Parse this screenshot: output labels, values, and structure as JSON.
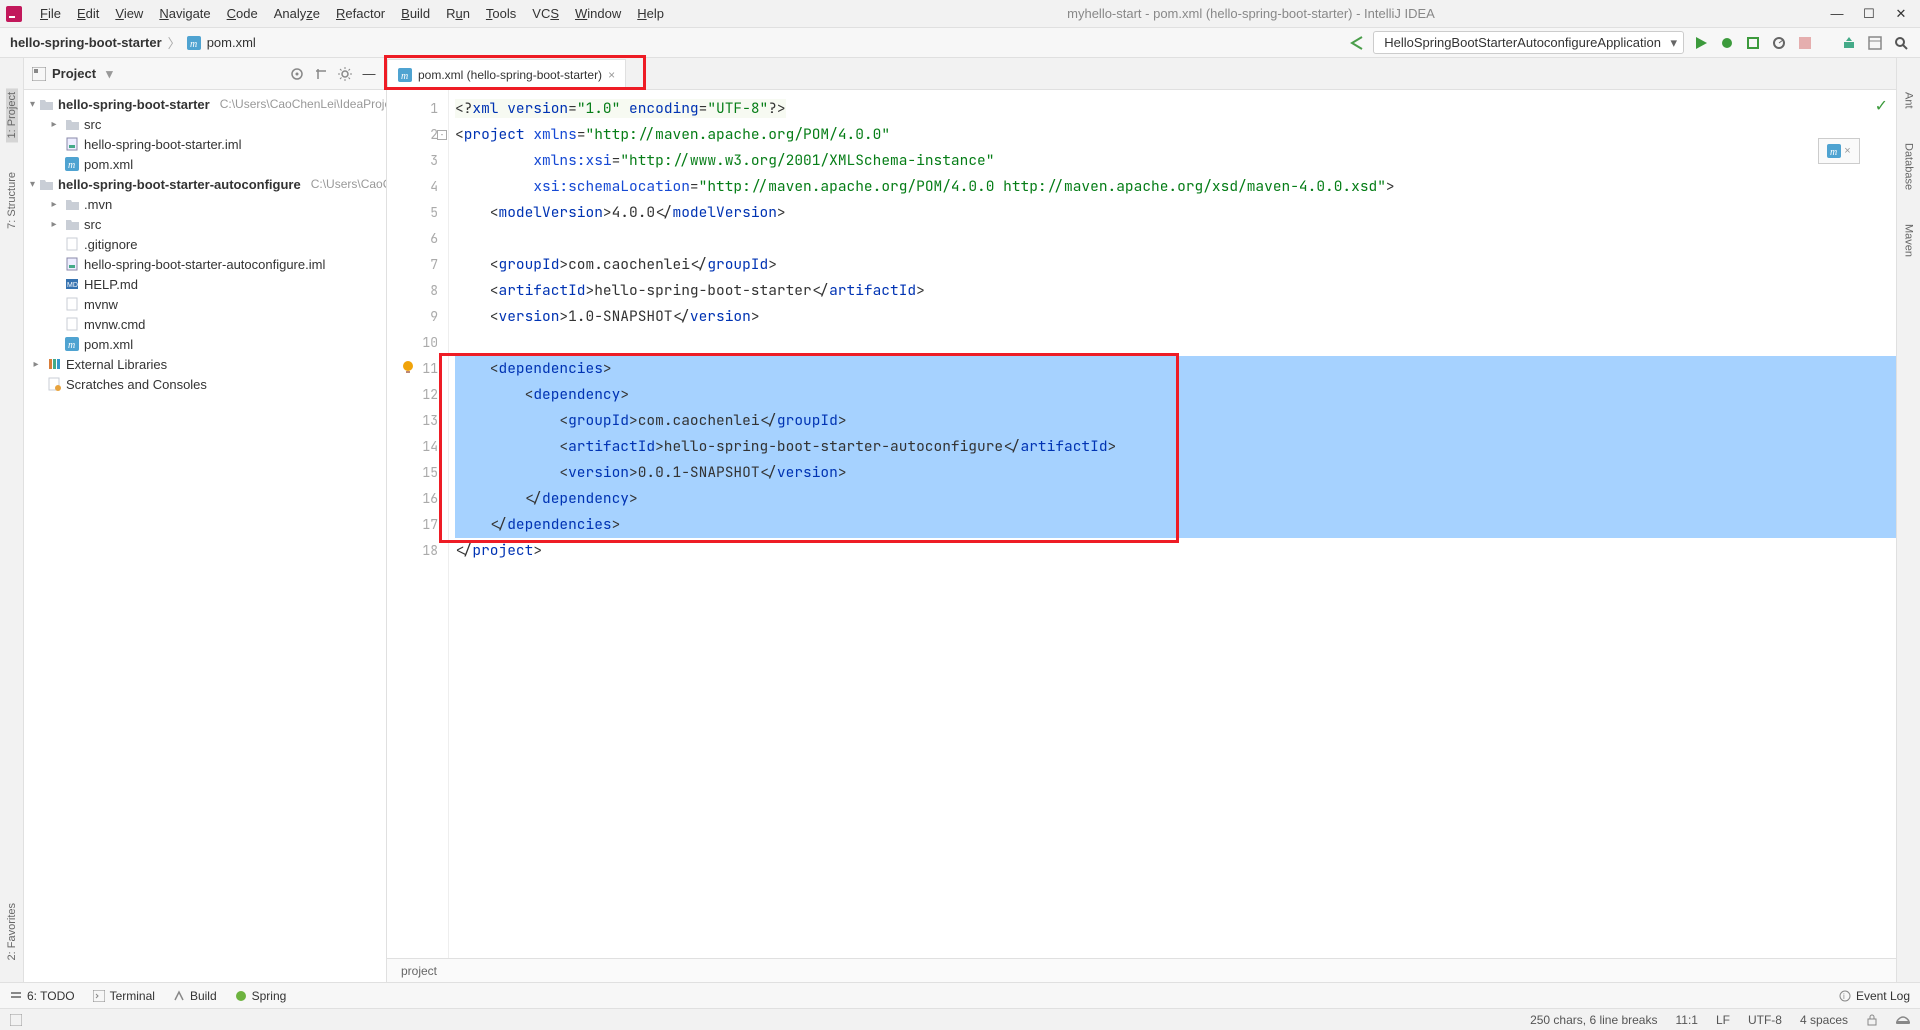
{
  "window_title": "myhello-start - pom.xml (hello-spring-boot-starter) - IntelliJ IDEA",
  "menu": [
    "File",
    "Edit",
    "View",
    "Navigate",
    "Code",
    "Analyze",
    "Refactor",
    "Build",
    "Run",
    "Tools",
    "VCS",
    "Window",
    "Help"
  ],
  "breadcrumb": {
    "root": "hello-spring-boot-starter",
    "file": "pom.xml"
  },
  "run_config": "HelloSpringBootStarterAutoconfigureApplication",
  "project_panel": {
    "title": "Project",
    "tree": [
      {
        "level": 0,
        "arrow": "open",
        "icon": "folder",
        "name": "hello-spring-boot-starter",
        "bold": true,
        "path": "C:\\Users\\CaoChenLei\\IdeaProjects"
      },
      {
        "level": 1,
        "arrow": "closed",
        "icon": "folder",
        "name": "src"
      },
      {
        "level": 1,
        "arrow": "",
        "icon": "iml",
        "name": "hello-spring-boot-starter.iml"
      },
      {
        "level": 1,
        "arrow": "",
        "icon": "m",
        "name": "pom.xml"
      },
      {
        "level": 0,
        "arrow": "open",
        "icon": "folder",
        "name": "hello-spring-boot-starter-autoconfigure",
        "bold": true,
        "path": "C:\\Users\\CaoC"
      },
      {
        "level": 1,
        "arrow": "closed",
        "icon": "folder",
        "name": ".mvn"
      },
      {
        "level": 1,
        "arrow": "closed",
        "icon": "folder",
        "name": "src"
      },
      {
        "level": 1,
        "arrow": "",
        "icon": "txt",
        "name": ".gitignore"
      },
      {
        "level": 1,
        "arrow": "",
        "icon": "iml",
        "name": "hello-spring-boot-starter-autoconfigure.iml"
      },
      {
        "level": 1,
        "arrow": "",
        "icon": "md",
        "name": "HELP.md"
      },
      {
        "level": 1,
        "arrow": "",
        "icon": "txt",
        "name": "mvnw"
      },
      {
        "level": 1,
        "arrow": "",
        "icon": "txt",
        "name": "mvnw.cmd"
      },
      {
        "level": 1,
        "arrow": "",
        "icon": "m",
        "name": "pom.xml"
      },
      {
        "level": 0,
        "arrow": "closed",
        "icon": "lib",
        "name": "External Libraries"
      },
      {
        "level": 0,
        "arrow": "",
        "icon": "scratch",
        "name": "Scratches and Consoles"
      }
    ]
  },
  "editor": {
    "tab_label": "pom.xml (hello-spring-boot-starter)",
    "breadcrumb": "project",
    "lines": 18
  },
  "left_rail": [
    "1: Project",
    "7: Structure",
    "2: Favorites"
  ],
  "right_rail": [
    "Ant",
    "Database",
    "Maven"
  ],
  "bottom_tools": [
    "6: TODO",
    "Terminal",
    "Build",
    "Spring"
  ],
  "event_log_label": "Event Log",
  "status": {
    "chars": "250 chars, 6 line breaks",
    "pos": "11:1",
    "line_sep": "LF",
    "enc": "UTF-8",
    "indent": "4 spaces"
  },
  "code_xml": {
    "pi": "<?xml version=\"1.0\" encoding=\"UTF-8\"?>",
    "xmlns": "http://maven.apache.org/POM/4.0.0",
    "xsi": "http://www.w3.org/2001/XMLSchema-instance",
    "schema": "http://maven.apache.org/POM/4.0.0 http://maven.apache.org/xsd/maven-4.0.0.xsd",
    "modelVersion": "4.0.0",
    "groupId": "com.caochenlei",
    "artifactId": "hello-spring-boot-starter",
    "version": "1.0-SNAPSHOT",
    "dep_groupId": "com.caochenlei",
    "dep_artifactId": "hello-spring-boot-starter-autoconfigure",
    "dep_version": "0.0.1-SNAPSHOT"
  }
}
